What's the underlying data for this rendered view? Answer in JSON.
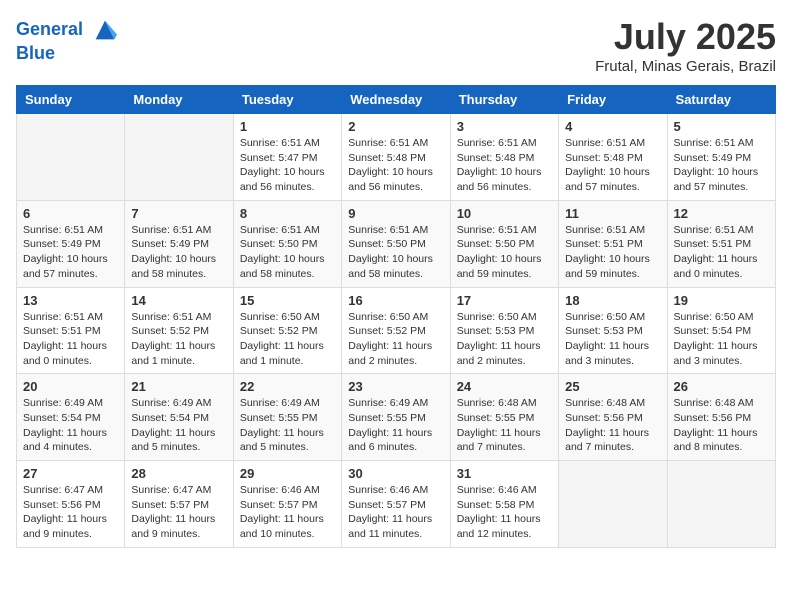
{
  "header": {
    "logo_line1": "General",
    "logo_line2": "Blue",
    "month_title": "July 2025",
    "location": "Frutal, Minas Gerais, Brazil"
  },
  "days_of_week": [
    "Sunday",
    "Monday",
    "Tuesday",
    "Wednesday",
    "Thursday",
    "Friday",
    "Saturday"
  ],
  "weeks": [
    [
      {
        "day": "",
        "info": ""
      },
      {
        "day": "",
        "info": ""
      },
      {
        "day": "1",
        "info": "Sunrise: 6:51 AM\nSunset: 5:47 PM\nDaylight: 10 hours and 56 minutes."
      },
      {
        "day": "2",
        "info": "Sunrise: 6:51 AM\nSunset: 5:48 PM\nDaylight: 10 hours and 56 minutes."
      },
      {
        "day": "3",
        "info": "Sunrise: 6:51 AM\nSunset: 5:48 PM\nDaylight: 10 hours and 56 minutes."
      },
      {
        "day": "4",
        "info": "Sunrise: 6:51 AM\nSunset: 5:48 PM\nDaylight: 10 hours and 57 minutes."
      },
      {
        "day": "5",
        "info": "Sunrise: 6:51 AM\nSunset: 5:49 PM\nDaylight: 10 hours and 57 minutes."
      }
    ],
    [
      {
        "day": "6",
        "info": "Sunrise: 6:51 AM\nSunset: 5:49 PM\nDaylight: 10 hours and 57 minutes."
      },
      {
        "day": "7",
        "info": "Sunrise: 6:51 AM\nSunset: 5:49 PM\nDaylight: 10 hours and 58 minutes."
      },
      {
        "day": "8",
        "info": "Sunrise: 6:51 AM\nSunset: 5:50 PM\nDaylight: 10 hours and 58 minutes."
      },
      {
        "day": "9",
        "info": "Sunrise: 6:51 AM\nSunset: 5:50 PM\nDaylight: 10 hours and 58 minutes."
      },
      {
        "day": "10",
        "info": "Sunrise: 6:51 AM\nSunset: 5:50 PM\nDaylight: 10 hours and 59 minutes."
      },
      {
        "day": "11",
        "info": "Sunrise: 6:51 AM\nSunset: 5:51 PM\nDaylight: 10 hours and 59 minutes."
      },
      {
        "day": "12",
        "info": "Sunrise: 6:51 AM\nSunset: 5:51 PM\nDaylight: 11 hours and 0 minutes."
      }
    ],
    [
      {
        "day": "13",
        "info": "Sunrise: 6:51 AM\nSunset: 5:51 PM\nDaylight: 11 hours and 0 minutes."
      },
      {
        "day": "14",
        "info": "Sunrise: 6:51 AM\nSunset: 5:52 PM\nDaylight: 11 hours and 1 minute."
      },
      {
        "day": "15",
        "info": "Sunrise: 6:50 AM\nSunset: 5:52 PM\nDaylight: 11 hours and 1 minute."
      },
      {
        "day": "16",
        "info": "Sunrise: 6:50 AM\nSunset: 5:52 PM\nDaylight: 11 hours and 2 minutes."
      },
      {
        "day": "17",
        "info": "Sunrise: 6:50 AM\nSunset: 5:53 PM\nDaylight: 11 hours and 2 minutes."
      },
      {
        "day": "18",
        "info": "Sunrise: 6:50 AM\nSunset: 5:53 PM\nDaylight: 11 hours and 3 minutes."
      },
      {
        "day": "19",
        "info": "Sunrise: 6:50 AM\nSunset: 5:54 PM\nDaylight: 11 hours and 3 minutes."
      }
    ],
    [
      {
        "day": "20",
        "info": "Sunrise: 6:49 AM\nSunset: 5:54 PM\nDaylight: 11 hours and 4 minutes."
      },
      {
        "day": "21",
        "info": "Sunrise: 6:49 AM\nSunset: 5:54 PM\nDaylight: 11 hours and 5 minutes."
      },
      {
        "day": "22",
        "info": "Sunrise: 6:49 AM\nSunset: 5:55 PM\nDaylight: 11 hours and 5 minutes."
      },
      {
        "day": "23",
        "info": "Sunrise: 6:49 AM\nSunset: 5:55 PM\nDaylight: 11 hours and 6 minutes."
      },
      {
        "day": "24",
        "info": "Sunrise: 6:48 AM\nSunset: 5:55 PM\nDaylight: 11 hours and 7 minutes."
      },
      {
        "day": "25",
        "info": "Sunrise: 6:48 AM\nSunset: 5:56 PM\nDaylight: 11 hours and 7 minutes."
      },
      {
        "day": "26",
        "info": "Sunrise: 6:48 AM\nSunset: 5:56 PM\nDaylight: 11 hours and 8 minutes."
      }
    ],
    [
      {
        "day": "27",
        "info": "Sunrise: 6:47 AM\nSunset: 5:56 PM\nDaylight: 11 hours and 9 minutes."
      },
      {
        "day": "28",
        "info": "Sunrise: 6:47 AM\nSunset: 5:57 PM\nDaylight: 11 hours and 9 minutes."
      },
      {
        "day": "29",
        "info": "Sunrise: 6:46 AM\nSunset: 5:57 PM\nDaylight: 11 hours and 10 minutes."
      },
      {
        "day": "30",
        "info": "Sunrise: 6:46 AM\nSunset: 5:57 PM\nDaylight: 11 hours and 11 minutes."
      },
      {
        "day": "31",
        "info": "Sunrise: 6:46 AM\nSunset: 5:58 PM\nDaylight: 11 hours and 12 minutes."
      },
      {
        "day": "",
        "info": ""
      },
      {
        "day": "",
        "info": ""
      }
    ]
  ]
}
